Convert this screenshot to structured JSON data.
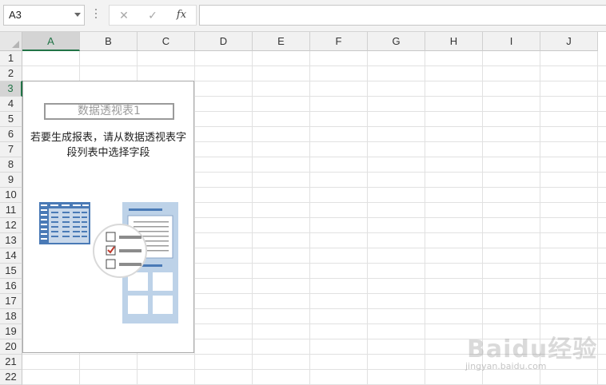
{
  "formula_bar": {
    "name_box": "A3",
    "cancel_icon": "cancel-icon",
    "enter_icon": "check-icon",
    "fx_label": "fx",
    "formula_value": ""
  },
  "sheet": {
    "columns": [
      "A",
      "B",
      "C",
      "D",
      "E",
      "F",
      "G",
      "H",
      "I",
      "J"
    ],
    "rows": [
      "1",
      "2",
      "3",
      "4",
      "5",
      "6",
      "7",
      "8",
      "9",
      "10",
      "11",
      "12",
      "13",
      "14",
      "15",
      "16",
      "17",
      "18",
      "19",
      "20",
      "21",
      "22"
    ],
    "selected_column": "A",
    "selected_row": "3",
    "accent_color": "#217346"
  },
  "pivot": {
    "title": "数据透视表1",
    "message": "若要生成报表，请从数据透视表字段列表中选择字段",
    "illustration_icon": "pivot-table-illustration"
  },
  "watermark": {
    "logo_text": "Baidu经验",
    "url_text": "jingyan.baidu.com"
  }
}
